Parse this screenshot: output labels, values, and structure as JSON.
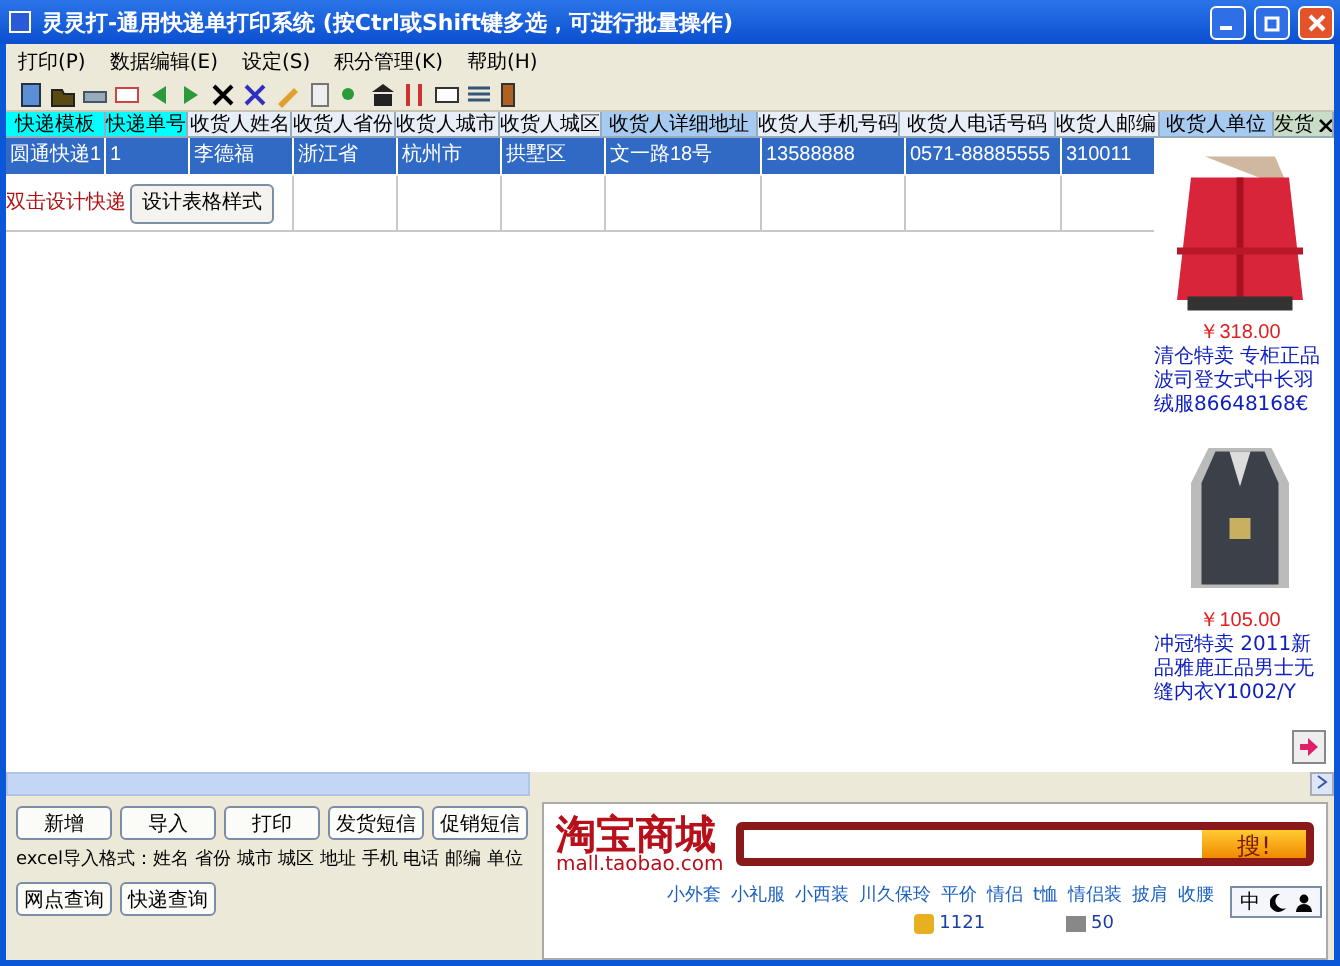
{
  "window": {
    "title": "灵灵打-通用快递单打印系统 (按Ctrl或Shift键多选，可进行批量操作)"
  },
  "menu": [
    "打印(P)",
    "数据编辑(E)",
    "设定(S)",
    "积分管理(K)",
    "帮助(H)"
  ],
  "table": {
    "columns": [
      {
        "label": "快递模板",
        "color": "#00ffff"
      },
      {
        "label": "快递单号",
        "color": "#00ffff"
      },
      {
        "label": "收货人姓名",
        "color": "#e8eef7"
      },
      {
        "label": "收货人省份",
        "color": "#e8eef7"
      },
      {
        "label": "收货人城市",
        "color": "#e8eef7"
      },
      {
        "label": "收货人城区",
        "color": "#e8eef7"
      },
      {
        "label": "收货人详细地址",
        "color": "#a6caf0"
      },
      {
        "label": "收货人手机号码",
        "color": "#e8eef7"
      },
      {
        "label": "收货人电话号码",
        "color": "#e8eef7"
      },
      {
        "label": "收货人邮编",
        "color": "#e8eef7"
      },
      {
        "label": "收货人单位",
        "color": "#a6caf0"
      },
      {
        "label": "发货",
        "color": "#c8dcc8"
      }
    ],
    "rows": [
      {
        "selected": true,
        "cells": [
          "圆通快递1",
          "1",
          "李德福",
          "浙江省",
          "杭州市",
          "拱墅区",
          "文一路18号",
          "13588888",
          "0571-88885555",
          "310011"
        ]
      }
    ],
    "design_hint": "双击设计快递",
    "design_button": "设计表格样式"
  },
  "ads": [
    {
      "price": "￥318.00",
      "title": "清仓特卖 专柜正品波司登女式中长羽绒服86648168€"
    },
    {
      "price": "￥105.00",
      "title": "冲冠特卖 2011新品雅鹿正品男士无缝内衣Y1002/Y"
    }
  ],
  "buttons": [
    "新增",
    "导入",
    "打印",
    "发货短信",
    "促销短信"
  ],
  "format_hint": "excel导入格式：姓名 省份 城市 城区 地址  手机 电话 邮编 单位",
  "query_buttons": [
    "网点查询",
    "快递查询"
  ],
  "taobao": {
    "logo": "淘宝商城",
    "domain": "mall.taobao.com",
    "search_button": "搜!",
    "links": [
      "小外套",
      "小礼服",
      "小西装",
      "川久保玲",
      "平价",
      "情侣",
      "t恤",
      "情侣装",
      "披肩",
      "收腰"
    ]
  },
  "status": [
    "1121",
    "50"
  ],
  "ime": "中"
}
